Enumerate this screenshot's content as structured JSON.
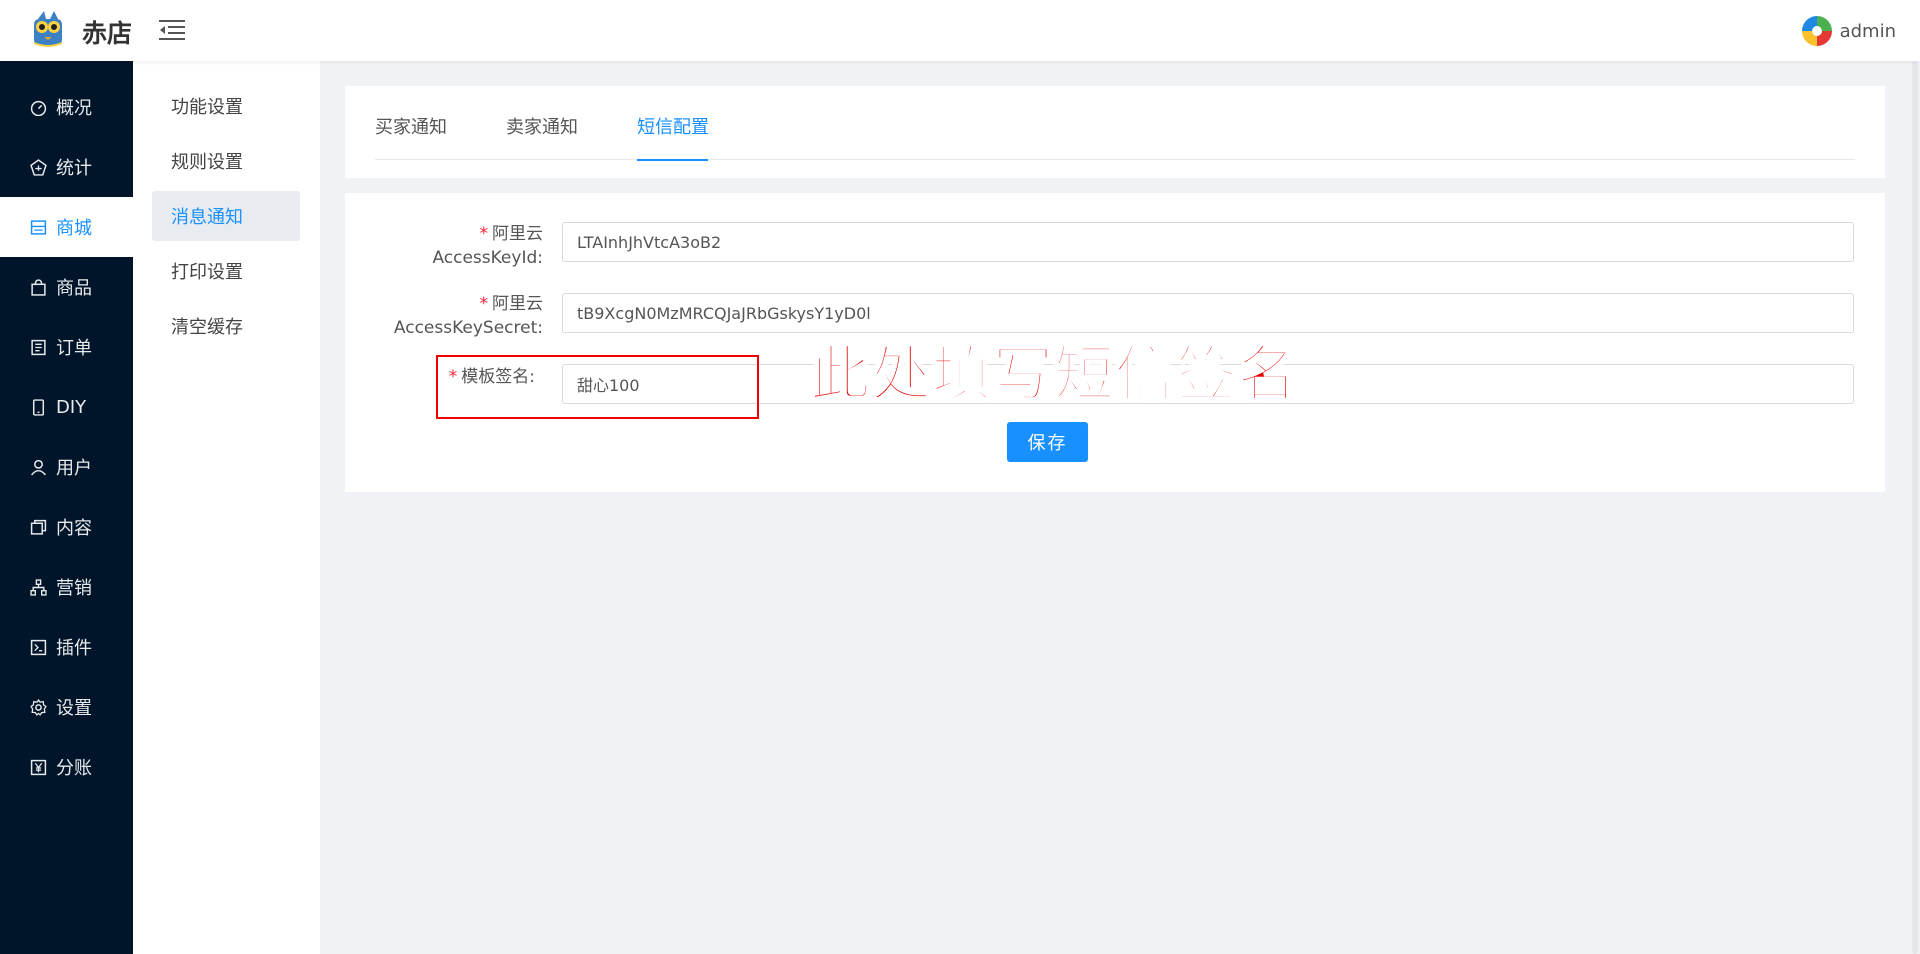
{
  "header": {
    "app_title": "赤店",
    "user_name": "admin",
    "icons": {
      "logo": "mascot-logo-icon",
      "collapse": "menu-fold-icon",
      "avatar": "colorful-avatar-icon"
    }
  },
  "main_nav": {
    "items": [
      {
        "label": "概况",
        "icon": "dashboard-icon"
      },
      {
        "label": "统计",
        "icon": "stats-icon"
      },
      {
        "label": "商城",
        "icon": "store-icon",
        "active": true
      },
      {
        "label": "商品",
        "icon": "bag-icon"
      },
      {
        "label": "订单",
        "icon": "order-icon"
      },
      {
        "label": "DIY",
        "icon": "phone-icon"
      },
      {
        "label": "用户",
        "icon": "user-icon"
      },
      {
        "label": "内容",
        "icon": "content-icon"
      },
      {
        "label": "营销",
        "icon": "marketing-icon"
      },
      {
        "label": "插件",
        "icon": "plugin-icon"
      },
      {
        "label": "设置",
        "icon": "gear-icon"
      },
      {
        "label": "分账",
        "icon": "yen-icon"
      }
    ]
  },
  "sub_nav": {
    "items": [
      {
        "label": "功能设置"
      },
      {
        "label": "规则设置"
      },
      {
        "label": "消息通知",
        "active": true
      },
      {
        "label": "打印设置"
      },
      {
        "label": "清空缓存"
      }
    ]
  },
  "tabs": {
    "items": [
      {
        "label": "买家通知"
      },
      {
        "label": "卖家通知"
      },
      {
        "label": "短信配置",
        "active": true
      }
    ]
  },
  "form": {
    "access_key_id": {
      "label_line1": "阿里云",
      "label_line2": "AccessKeyId:",
      "value": "LTAInhJhVtcA3oB2"
    },
    "access_key_secret": {
      "label_line1": "阿里云",
      "label_line2": "AccessKeySecret:",
      "value": "tB9XcgN0MzMRCQJaJRbGskysY1yD0l"
    },
    "template_sign": {
      "label": "模板签名:",
      "value": "甜心100"
    },
    "required_mark": "*",
    "save_label": "保存"
  },
  "annotation": {
    "text": "此处填写短信签名",
    "color": "#e60000"
  },
  "colors": {
    "accent": "#1890ff",
    "sidebar": "#001529",
    "required": "#f5222d"
  }
}
